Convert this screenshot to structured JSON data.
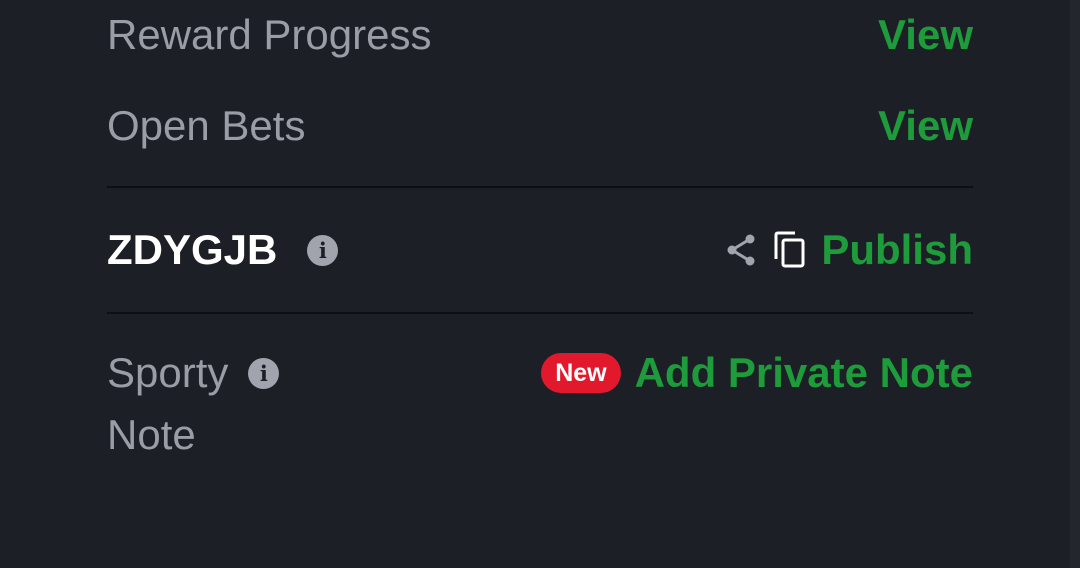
{
  "rows": {
    "reward_progress": {
      "label": "Reward Progress",
      "action": "View"
    },
    "open_bets": {
      "label": "Open Bets",
      "action": "View"
    }
  },
  "booking": {
    "code": "ZDYGJB",
    "info_icon": "info-icon",
    "share_icon": "share-icon",
    "copy_icon": "copy-icon",
    "publish_label": "Publish"
  },
  "note": {
    "label_line1": "Sporty",
    "label_line2": "Note",
    "info_icon": "info-icon",
    "badge": "New",
    "action": "Add Private Note"
  },
  "colors": {
    "background": "#1d1f26",
    "accent_green": "#1e9b3a",
    "badge_red": "#e2192c",
    "muted_text": "#9a9ca6"
  }
}
